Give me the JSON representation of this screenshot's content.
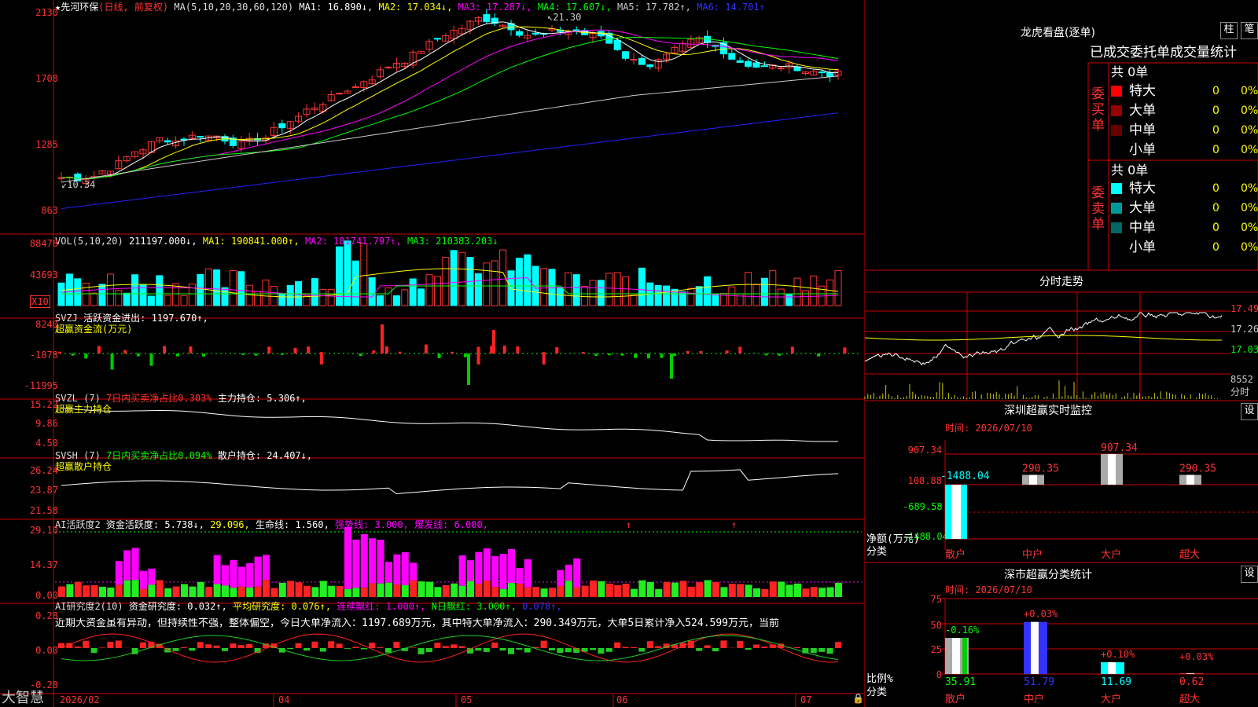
{
  "kline": {
    "title_star": "★",
    "title_name": "先河环保",
    "title_mode": "(日线, 前复权)",
    "ma_label": "MA(5,10,20,30,60,120)",
    "ma1": "MA1: 16.890↓,",
    "ma2": "MA2: 17.034↓,",
    "ma3": "MA3: 17.287↓,",
    "ma4": "MA4: 17.607↓,",
    "ma5": "MA5: 17.782↑,",
    "ma6": "MA6: 14.701↑",
    "y_labels": [
      "2130",
      "1708",
      "1285",
      "863"
    ],
    "high_note": "21.30",
    "low_note": "10.34"
  },
  "vol": {
    "label": "VOL(5,10,20)",
    "value": "211197.000↓,",
    "ma1": "MA1: 190841.000↑,",
    "ma2": "MA2: 181741.797↑,",
    "ma3": "MA3: 210383.203↓",
    "y_labels": [
      "88478",
      "43693"
    ],
    "unit": "X10"
  },
  "svzj": {
    "label": "SVZJ",
    "line1": "活跃资金进出: 1197.670↑,",
    "line2": "超赢资金流(万元)",
    "y_labels": [
      "8240",
      "-1878",
      "-11995"
    ]
  },
  "svzl": {
    "label": "SVZL (7)",
    "ratio": "7日内买卖净占比0.303%",
    "hold": "主力持仓: 5.306↑,",
    "line2": "超赢主力持仓",
    "y_labels": [
      "15.22",
      "9.86",
      "4.50"
    ]
  },
  "svsh": {
    "label": "SVSH (7)",
    "ratio": "7日内买卖净占比0.094%",
    "hold": "散户持仓: 24.407↓,",
    "line2": "超赢散户持仓",
    "y_labels": [
      "26.24",
      "23.87",
      "21.58"
    ]
  },
  "ai1": {
    "label": "AI活跃度2",
    "a": "资金活跃度: 5.738↓,",
    "b": "29.096,",
    "c": "生命线: 1.560,",
    "d": "强势线: 3.000,",
    "e": "爆发线: 6.000,",
    "y_labels": [
      "29.10",
      "14.37",
      "0.00"
    ]
  },
  "ai2": {
    "label": "AI研究度2(10)",
    "a": "资金研究度: 0.032↑,",
    "b": "平均研究度: 0.076↑,",
    "c": "连续飘红: 1.000↑,",
    "d": "N日飘红: 3.000↑,",
    "e": "0.078↑,",
    "text": "近期大资金虽有异动，但持续性不强，整体偏空，今日大单净流入：1197.689万元，其中特大单净流入：290.349万元，大单5日累计净入524.599万元，当前",
    "y_labels": [
      "0.28",
      "0.00",
      "-0.28"
    ]
  },
  "xaxis": {
    "brand": "大智慧",
    "dates": [
      "2026/02",
      "04",
      "05",
      "06",
      "07"
    ]
  },
  "dragon": {
    "title": "龙虎看盘(逐单)",
    "btn1": "柱",
    "btn2": "笔",
    "header": "已成交委托单成交量统计",
    "buy_label": "委买单",
    "sell_label": "委卖单",
    "buy_total": "共 0单",
    "sell_total": "共 0单",
    "buy_rows": [
      {
        "name": "特大",
        "val": "0",
        "pct": "0%",
        "color": "#ff0000"
      },
      {
        "name": "大单",
        "val": "0",
        "pct": "0%",
        "color": "#990000"
      },
      {
        "name": "中单",
        "val": "0",
        "pct": "0%",
        "color": "#660000"
      },
      {
        "name": "小单",
        "val": "0",
        "pct": "0%",
        "color": "#000000"
      }
    ],
    "sell_rows": [
      {
        "name": "特大",
        "val": "0",
        "pct": "0%",
        "color": "#00ffff"
      },
      {
        "name": "大单",
        "val": "0",
        "pct": "0%",
        "color": "#009999"
      },
      {
        "name": "中单",
        "val": "0",
        "pct": "0%",
        "color": "#006666"
      },
      {
        "name": "小单",
        "val": "0",
        "pct": "0%",
        "color": "#000000"
      }
    ]
  },
  "intraday": {
    "title": "分时走势",
    "prices": [
      "17.49",
      "17.26",
      "17.03"
    ],
    "vol": "8552",
    "unit": "分时"
  },
  "monitor": {
    "title": "深圳超赢实时监控",
    "btn": "设",
    "time": "时间: 2026/07/10",
    "y_labels": [
      "907.34",
      "108.88",
      "-689.58",
      "-1488.04"
    ],
    "categories": [
      "散户",
      "中户",
      "大户",
      "超大"
    ],
    "values": [
      -1488.04,
      290.35,
      907.34,
      290.35
    ],
    "value_labels": [
      "-1488.04",
      "290.35",
      "907.34",
      "290.35"
    ],
    "axis_label1": "净额(万元)",
    "axis_label2": "分类"
  },
  "stats": {
    "title": "深市超赢分类统计",
    "btn": "设",
    "time": "时间: 2026/07/10",
    "y_labels": [
      "75",
      "50",
      "25",
      "0"
    ],
    "categories": [
      "散户",
      "中户",
      "大户",
      "超大"
    ],
    "values": [
      35.91,
      51.79,
      11.69,
      0.62
    ],
    "value_labels": [
      "35.91",
      "51.79",
      "11.69",
      "0.62"
    ],
    "changes": [
      "-0.16%",
      "+0.03%",
      "+0.10%",
      "+0.03%"
    ],
    "axis_label1": "比例%",
    "axis_label2": "分类"
  }
}
